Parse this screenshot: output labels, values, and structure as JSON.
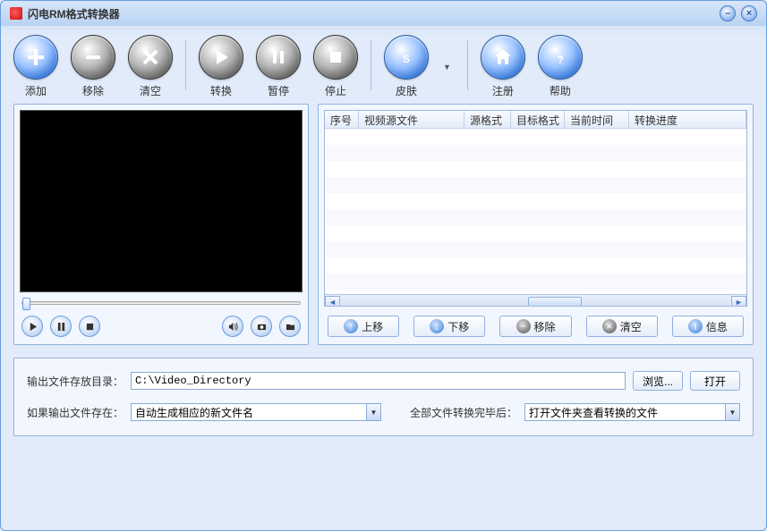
{
  "window": {
    "title": "闪电RM格式转换器"
  },
  "toolbar": {
    "add": "添加",
    "remove": "移除",
    "clear": "清空",
    "convert": "转换",
    "pause": "暂停",
    "stop": "停止",
    "skin": "皮肤",
    "register": "注册",
    "help": "帮助"
  },
  "table": {
    "columns": [
      "序号",
      "视频源文件",
      "源格式",
      "目标格式",
      "当前时间",
      "转换进度"
    ]
  },
  "list_buttons": {
    "move_up": "上移",
    "move_down": "下移",
    "remove": "移除",
    "clear": "清空",
    "info": "信息"
  },
  "output": {
    "dir_label": "输出文件存放目录：",
    "dir_value": "C:\\Video_Directory",
    "browse": "浏览...",
    "open": "打开",
    "exists_label": "如果输出文件存在：",
    "exists_value": "自动生成相应的新文件名",
    "after_label": "全部文件转换完毕后：",
    "after_value": "打开文件夹查看转换的文件"
  }
}
